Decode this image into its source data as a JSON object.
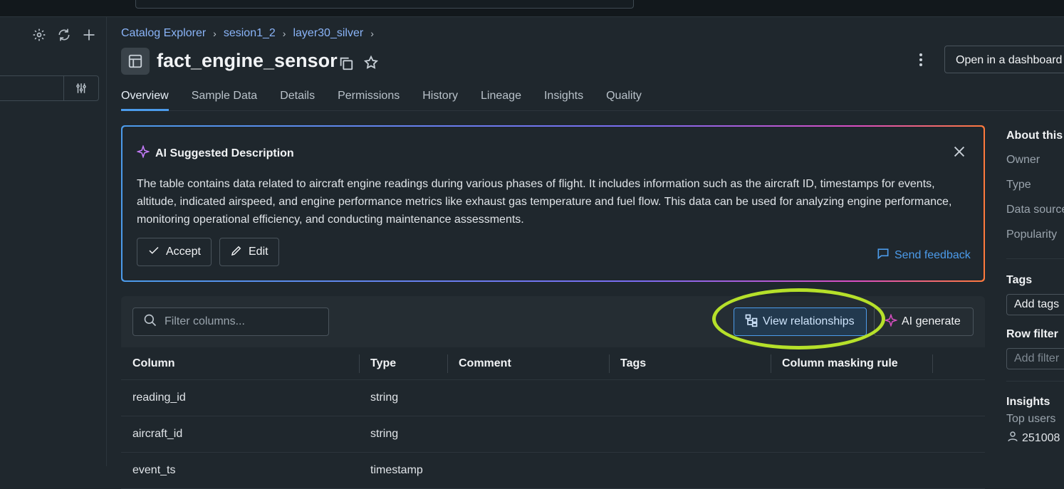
{
  "breadcrumb": [
    "Catalog Explorer",
    "sesion1_2",
    "layer30_silver"
  ],
  "table_name": "fact_engine_sensor",
  "header": {
    "open_dashboard": "Open in a dashboard"
  },
  "tabs": [
    "Overview",
    "Sample Data",
    "Details",
    "Permissions",
    "History",
    "Lineage",
    "Insights",
    "Quality"
  ],
  "ai_description": {
    "title": "AI Suggested Description",
    "text": "The table contains data related to aircraft engine readings during various phases of flight. It includes information such as the aircraft ID, timestamps for events, altitude, indicated airspeed, and engine performance metrics like exhaust gas temperature and fuel flow. This data can be used for analyzing engine performance, monitoring operational efficiency, and conducting maintenance assessments.",
    "accept_label": "Accept",
    "edit_label": "Edit",
    "feedback_label": "Send feedback"
  },
  "columns_panel": {
    "filter_placeholder": "Filter columns...",
    "view_relationships": "View relationships",
    "ai_generate": "AI generate",
    "headers": [
      "Column",
      "Type",
      "Comment",
      "Tags",
      "Column masking rule"
    ],
    "rows": [
      {
        "column": "reading_id",
        "type": "string"
      },
      {
        "column": "aircraft_id",
        "type": "string"
      },
      {
        "column": "event_ts",
        "type": "timestamp"
      }
    ]
  },
  "right_panel": {
    "about": "About this",
    "owner": "Owner",
    "type": "Type",
    "data_source": "Data source",
    "popularity": "Popularity",
    "tags_heading": "Tags",
    "add_tags": "Add tags",
    "row_filter_heading": "Row filter",
    "add_filter": "Add filter",
    "insights_heading": "Insights",
    "top_users": "Top users",
    "user": "251008"
  },
  "colors": {
    "accent": "#4c9bea",
    "highlight": "#b6e02a"
  }
}
